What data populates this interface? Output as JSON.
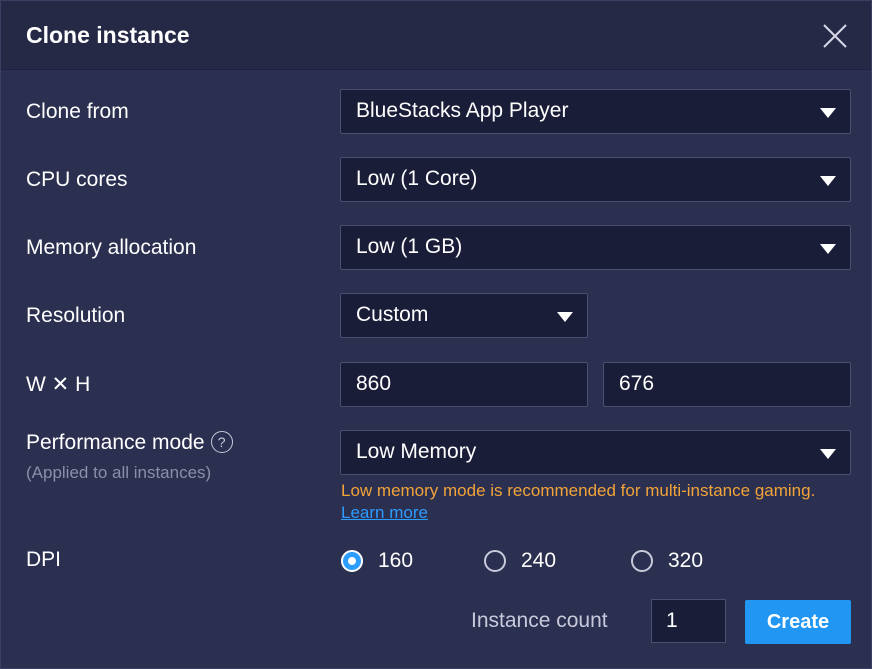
{
  "dialog": {
    "title": "Clone instance",
    "close_icon": "close-icon"
  },
  "fields": {
    "clone_from": {
      "label": "Clone from",
      "value": "BlueStacks App Player"
    },
    "cpu_cores": {
      "label": "CPU cores",
      "value": "Low (1 Core)"
    },
    "memory": {
      "label": "Memory allocation",
      "value": "Low (1 GB)"
    },
    "resolution": {
      "label": "Resolution",
      "value": "Custom"
    },
    "wxh": {
      "label": "W ✕ H",
      "width": "860",
      "height": "676"
    },
    "performance": {
      "label": "Performance mode",
      "help_icon": "?",
      "sublabel": "(Applied to all instances)",
      "value": "Low Memory",
      "note": "Low memory mode is recommended for multi-instance gaming.",
      "note_link": "Learn more"
    },
    "dpi": {
      "label": "DPI",
      "options": [
        "160",
        "240",
        "320"
      ],
      "selected": "160"
    }
  },
  "footer": {
    "instance_count_label": "Instance count",
    "instance_count_value": "1",
    "create_label": "Create"
  },
  "colors": {
    "background": "#2b2f50",
    "field_bg": "#1a1d38",
    "accent": "#2196f3",
    "warning": "#f2a33a",
    "link": "#2d9cff"
  }
}
